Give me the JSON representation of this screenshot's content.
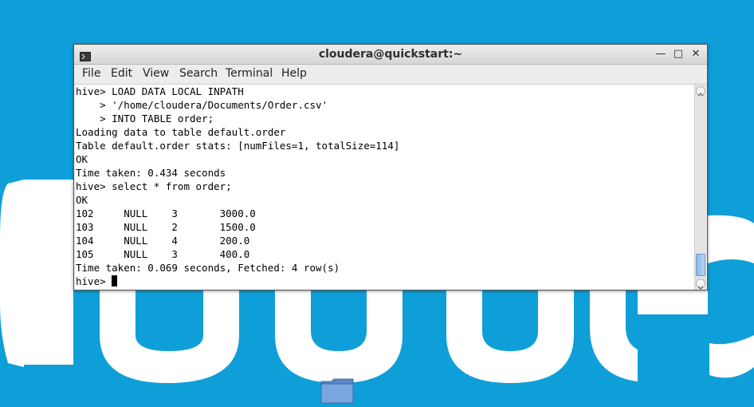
{
  "window": {
    "title": "cloudera@quickstart:~"
  },
  "menubar": {
    "items": [
      {
        "label": "File"
      },
      {
        "label": "Edit"
      },
      {
        "label": "View"
      },
      {
        "label": "Search"
      },
      {
        "label": "Terminal"
      },
      {
        "label": "Help"
      }
    ]
  },
  "terminal": {
    "lines": [
      "hive> LOAD DATA LOCAL INPATH",
      "    > '/home/cloudera/Documents/Order.csv'",
      "    > INTO TABLE order;",
      "Loading data to table default.order",
      "Table default.order stats: [numFiles=1, totalSize=114]",
      "OK",
      "Time taken: 0.434 seconds",
      "hive> select * from order;",
      "OK",
      "102     NULL    3       3000.0",
      "103     NULL    2       1500.0",
      "104     NULL    4       200.0",
      "105     NULL    3       400.0",
      "Time taken: 0.069 seconds, Fetched: 4 row(s)"
    ],
    "prompt": "hive> "
  },
  "colors": {
    "desktop": "#0f9fd8",
    "terminal_bg": "#ffffff",
    "terminal_fg": "#000000"
  }
}
